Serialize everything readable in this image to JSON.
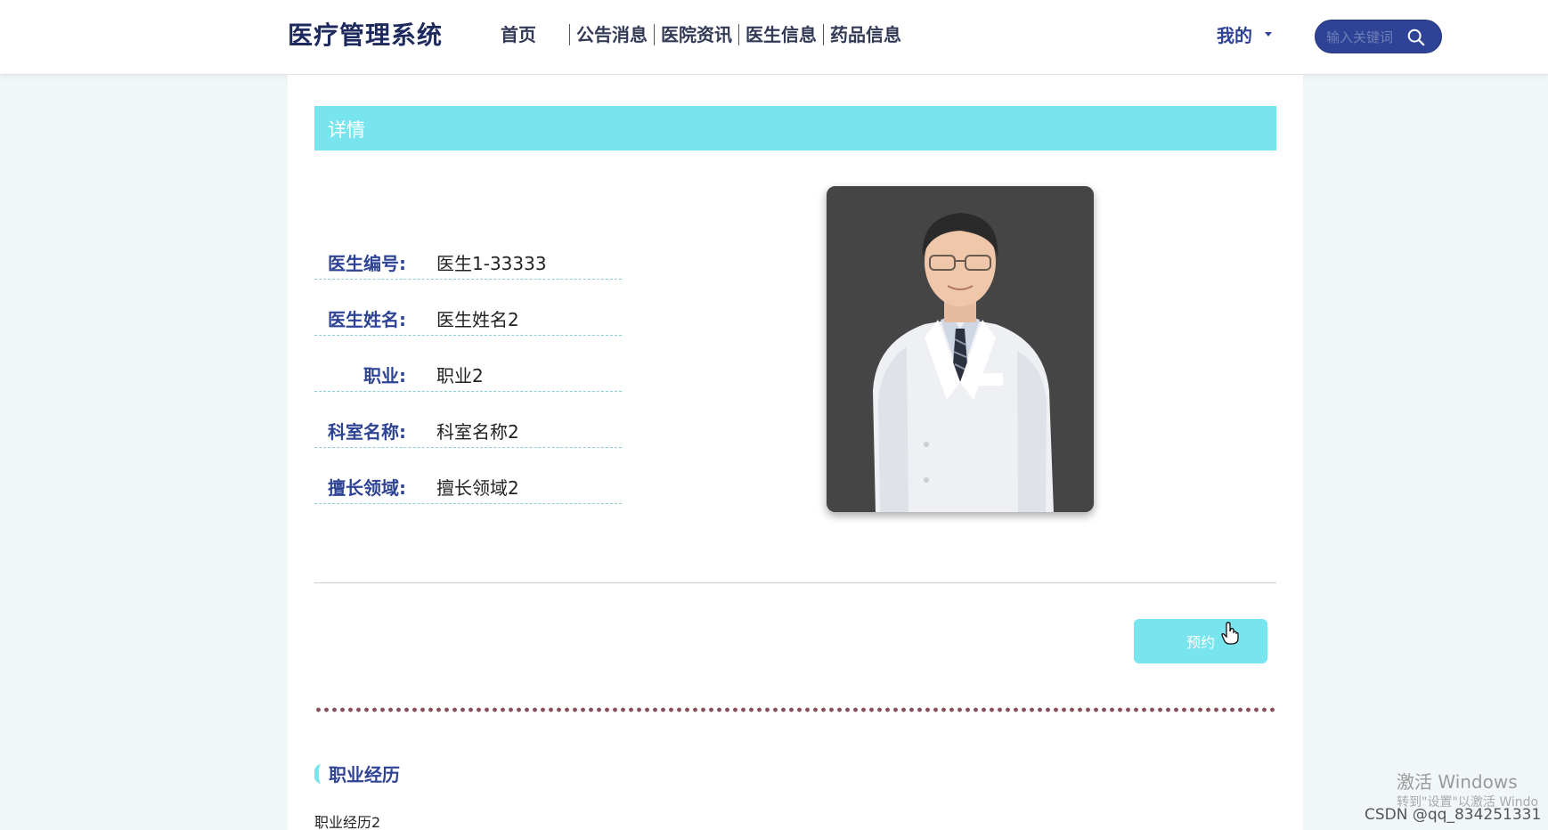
{
  "header": {
    "brand": "医疗管理系统",
    "nav": [
      "首页",
      "公告消息",
      "医院资讯",
      "医生信息",
      "药品信息"
    ],
    "user_menu": "我的",
    "search_placeholder": "输入关键词"
  },
  "detail": {
    "title": "详情",
    "fields": [
      {
        "label": "医生编号:",
        "value": "医生1-33333"
      },
      {
        "label": "医生姓名:",
        "value": "医生姓名2"
      },
      {
        "label": "职业:",
        "value": "职业2"
      },
      {
        "label": "科室名称:",
        "value": "科室名称2"
      },
      {
        "label": "擅长领域:",
        "value": "擅长领域2"
      }
    ],
    "book_button": "预约"
  },
  "section": {
    "title": "职业经历",
    "content": "职业经历2"
  },
  "overlay": {
    "activation_title": "激活 Windows",
    "activation_sub": "转到\"设置\"以激活 Windo",
    "csdn_tag": "CSDN @qq_834251331"
  },
  "colors": {
    "brand": "#1e2a5e",
    "accent": "#2f4396",
    "cyan": "#78e4ee"
  }
}
